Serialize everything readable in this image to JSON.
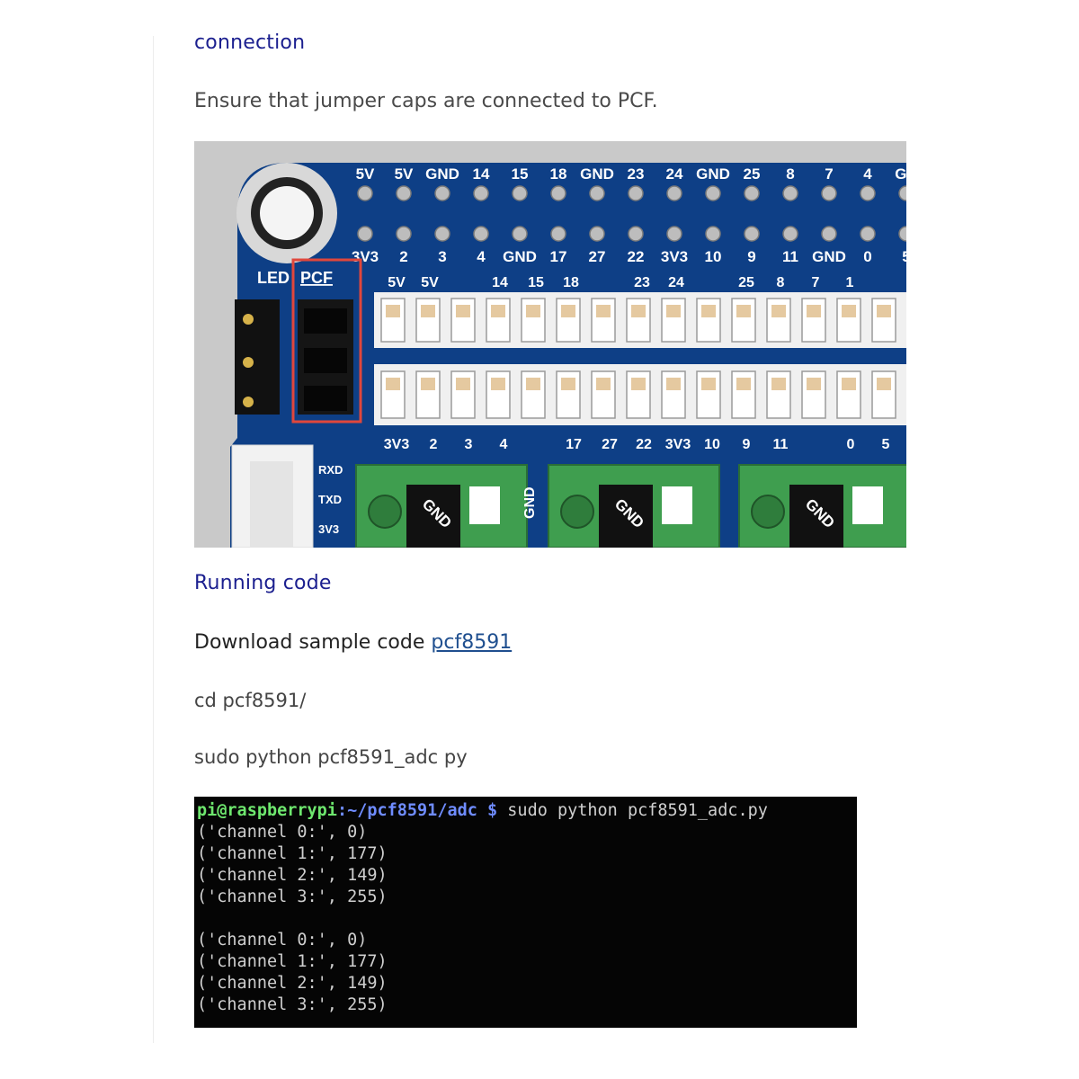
{
  "sections": {
    "connection_heading": "connection",
    "connection_text": "Ensure that jumper caps are connected to PCF.",
    "running_heading": "Running code",
    "download_text": "Download sample code ",
    "download_link": "pcf8591",
    "cmd_cd": "cd pcf8591/",
    "cmd_run": "sudo python pcf8591_adc py"
  },
  "board": {
    "top_header_labels": [
      "5V",
      "5V",
      "GND",
      "14",
      "15",
      "18",
      "GND",
      "23",
      "24",
      "GND",
      "25",
      "8",
      "7",
      "4",
      "GN"
    ],
    "bottom_header_labels": [
      "3V3",
      "2",
      "3",
      "4",
      "GND",
      "17",
      "27",
      "22",
      "3V3",
      "10",
      "9",
      "11",
      "GND",
      "0",
      "5"
    ],
    "led_label": "LED",
    "pcf_label": "PCF",
    "upper_led_labels": [
      "5V",
      "5V",
      "14",
      "15",
      "18",
      "23",
      "24",
      "25",
      "8",
      "7",
      "1"
    ],
    "lower_led_labels": [
      "3V3",
      "2",
      "3",
      "4",
      "17",
      "27",
      "22",
      "3V3",
      "10",
      "9",
      "11",
      "0",
      "5"
    ],
    "uart_labels": [
      "RXD",
      "TXD",
      "3V3"
    ],
    "terminal_labels": [
      "GND",
      "GND",
      "GND"
    ],
    "gnd_side_label": "GND",
    "colors": {
      "pcb": "#0e3f86",
      "terminal_block": "#3f9e4f",
      "highlight": "#e0473c"
    }
  },
  "terminal": {
    "prompt_user": "pi@raspberrypi",
    "prompt_path": ":~/pcf8591/adc $",
    "command": " sudo python pcf8591_adc.py",
    "lines_1": [
      "('channel 0:', 0)",
      "('channel 1:', 177)",
      "('channel 2:', 149)",
      "('channel 3:', 255)"
    ],
    "lines_2": [
      "('channel 0:', 0)",
      "('channel 1:', 177)",
      "('channel 2:', 149)",
      "('channel 3:', 255)"
    ]
  }
}
